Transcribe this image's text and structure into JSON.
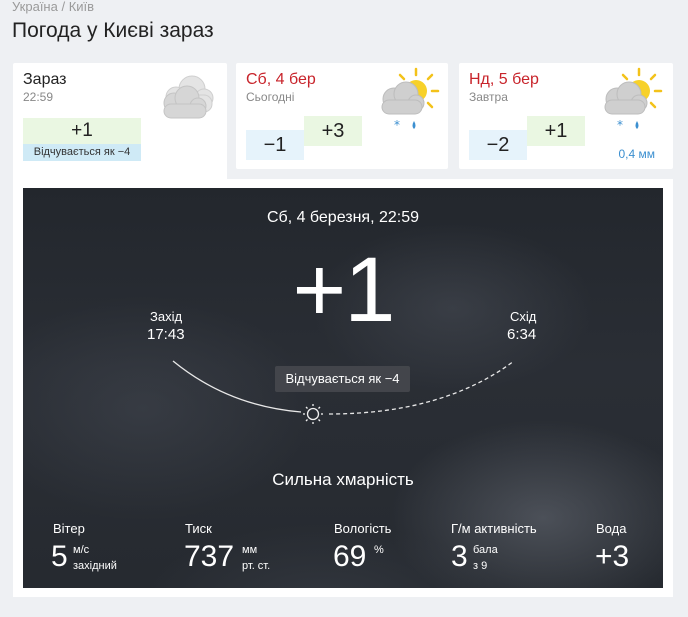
{
  "breadcrumb": {
    "country": "Україна",
    "separator": " / ",
    "city": "Київ"
  },
  "page_title": "Погода у Києві зараз",
  "now_tab": {
    "title": "Зараз",
    "time": "22:59",
    "temp": "+1",
    "feels": "Відчувається як −4",
    "icon": "cloudy-icon"
  },
  "day_tabs": [
    {
      "title": "Сб, 4 бер",
      "sub": "Сьогодні",
      "min": "−1",
      "max": "+3",
      "precip": "",
      "icon": "partly-cloudy-snow-rain-icon"
    },
    {
      "title": "Нд, 5 бер",
      "sub": "Завтра",
      "min": "−2",
      "max": "+1",
      "precip": "0,4 мм",
      "icon": "partly-cloudy-snow-rain-icon"
    }
  ],
  "current": {
    "datetime": "Сб, 4 березня, 22:59",
    "temp": "+1",
    "sunset_label": "Захід",
    "sunset_time": "17:43",
    "sunrise_label": "Схід",
    "sunrise_time": "6:34",
    "feels": "Відчувається як −4",
    "condition": "Сильна хмарність"
  },
  "metrics": {
    "wind": {
      "label": "Вітер",
      "value": "5",
      "unit": "м/с",
      "extra": "західний"
    },
    "pressure": {
      "label": "Тиск",
      "value": "737",
      "unit": "мм",
      "extra": "рт. ст."
    },
    "humidity": {
      "label": "Вологість",
      "value": "69",
      "unit": "%"
    },
    "geomagnetic": {
      "label": "Г/м активність",
      "value": "3",
      "unit": "бала",
      "extra": "з 9"
    },
    "water": {
      "label": "Вода",
      "value": "+3"
    }
  },
  "colors": {
    "accent_red": "#c8242b",
    "precip_blue": "#3b8fd0",
    "cold_bg": "#e6f3fb",
    "warm_bg": "#eaf7e2"
  }
}
